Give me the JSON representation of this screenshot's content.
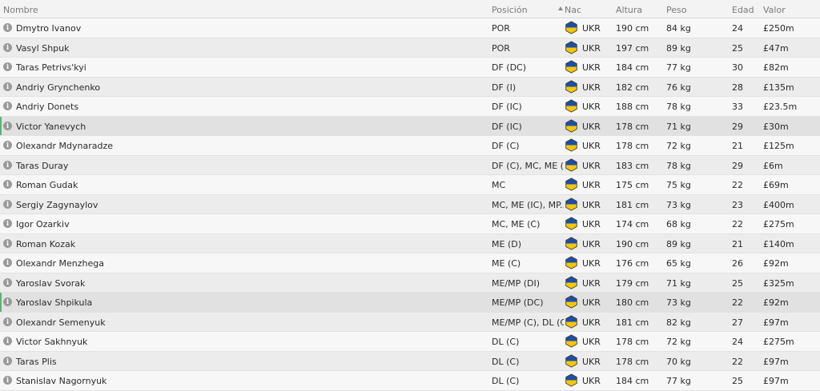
{
  "headers": {
    "nombre": "Nombre",
    "posicion": "Posición",
    "nac": "Nac",
    "altura": "Altura",
    "peso": "Peso",
    "edad": "Edad",
    "valor": "Valor"
  },
  "colors": {
    "flag_blue": "#1f4fa3",
    "flag_yellow": "#f4c60c",
    "selected_marker": "#5fb07a"
  },
  "players": [
    {
      "name": "Dmytro Ivanov",
      "pos": "POR",
      "nat": "UKR",
      "height": "190 cm",
      "weight": "84 kg",
      "age": "24",
      "value": "£250m"
    },
    {
      "name": "Vasyl Shpuk",
      "pos": "POR",
      "nat": "UKR",
      "height": "197 cm",
      "weight": "89 kg",
      "age": "25",
      "value": "£47m"
    },
    {
      "name": "Taras Petrivs'kyi",
      "pos": "DF (DC)",
      "nat": "UKR",
      "height": "184 cm",
      "weight": "77 kg",
      "age": "30",
      "value": "£82m"
    },
    {
      "name": "Andriy Grynchenko",
      "pos": "DF (I)",
      "nat": "UKR",
      "height": "182 cm",
      "weight": "76 kg",
      "age": "28",
      "value": "£135m"
    },
    {
      "name": "Andriy Donets",
      "pos": "DF (IC)",
      "nat": "UKR",
      "height": "188 cm",
      "weight": "78 kg",
      "age": "33",
      "value": "£23.5m"
    },
    {
      "name": "Victor Yanevych",
      "pos": "DF (IC)",
      "nat": "UKR",
      "height": "178 cm",
      "weight": "71 kg",
      "age": "29",
      "value": "£30m"
    },
    {
      "name": "Olexandr Mdynaradze",
      "pos": "DF (C)",
      "nat": "UKR",
      "height": "178 cm",
      "weight": "72 kg",
      "age": "21",
      "value": "£125m"
    },
    {
      "name": "Taras Duray",
      "pos": "DF (C), MC, ME (",
      "nat": "UKR",
      "height": "183 cm",
      "weight": "78 kg",
      "age": "29",
      "value": "£6m"
    },
    {
      "name": "Roman Gudak",
      "pos": "MC",
      "nat": "UKR",
      "height": "175 cm",
      "weight": "75 kg",
      "age": "22",
      "value": "£69m"
    },
    {
      "name": "Sergiy Zagynaylov",
      "pos": "MC, ME (IC), MP...",
      "nat": "UKR",
      "height": "181 cm",
      "weight": "73 kg",
      "age": "23",
      "value": "£400m"
    },
    {
      "name": "Igor Ozarkiv",
      "pos": "MC, ME (C)",
      "nat": "UKR",
      "height": "174 cm",
      "weight": "68 kg",
      "age": "22",
      "value": "£275m"
    },
    {
      "name": "Roman Kozak",
      "pos": "ME (D)",
      "nat": "UKR",
      "height": "190 cm",
      "weight": "89 kg",
      "age": "21",
      "value": "£140m"
    },
    {
      "name": "Olexandr Menzhega",
      "pos": "ME (C)",
      "nat": "UKR",
      "height": "176 cm",
      "weight": "65 kg",
      "age": "26",
      "value": "£92m"
    },
    {
      "name": "Yaroslav Svorak",
      "pos": "ME/MP (DI)",
      "nat": "UKR",
      "height": "179 cm",
      "weight": "71 kg",
      "age": "25",
      "value": "£325m"
    },
    {
      "name": "Yaroslav Shpikula",
      "pos": "ME/MP (DC)",
      "nat": "UKR",
      "height": "180 cm",
      "weight": "73 kg",
      "age": "22",
      "value": "£92m"
    },
    {
      "name": "Olexandr Semenyuk",
      "pos": "ME/MP (C), DL (C)",
      "nat": "UKR",
      "height": "181 cm",
      "weight": "82 kg",
      "age": "27",
      "value": "£97m"
    },
    {
      "name": "Victor Sakhnyuk",
      "pos": "DL (C)",
      "nat": "UKR",
      "height": "178 cm",
      "weight": "72 kg",
      "age": "24",
      "value": "£275m"
    },
    {
      "name": "Taras Plis",
      "pos": "DL (C)",
      "nat": "UKR",
      "height": "178 cm",
      "weight": "70 kg",
      "age": "22",
      "value": "£97m"
    },
    {
      "name": "Stanislav Nagornyuk",
      "pos": "DL (C)",
      "nat": "UKR",
      "height": "184 cm",
      "weight": "77 kg",
      "age": "25",
      "value": "£97m"
    }
  ],
  "selected_rows": [
    5,
    14
  ]
}
